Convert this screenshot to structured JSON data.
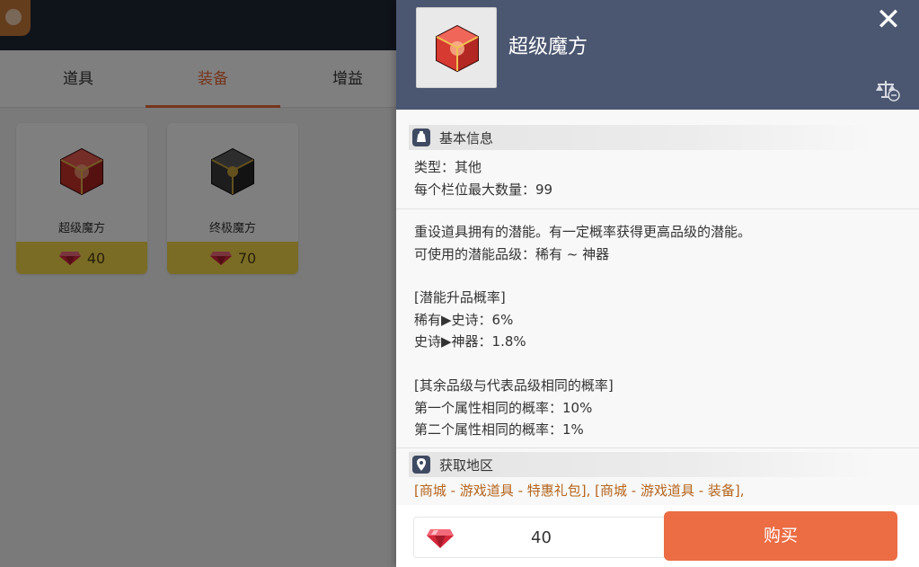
{
  "tabs": [
    {
      "label": "道具"
    },
    {
      "label": "装备"
    },
    {
      "label": "增益"
    }
  ],
  "items": [
    {
      "name": "超级魔方",
      "price": "40"
    },
    {
      "name": "终极魔方",
      "price": "70"
    }
  ],
  "detail": {
    "title": "超级魔方",
    "close_symbol": "✕",
    "basic_info": {
      "header": "基本信息",
      "type": "类型：其他",
      "max_stack": "每个栏位最大数量：99"
    },
    "description": {
      "line1": "重设道具拥有的潜能。有一定概率获得更高品级的潜能。",
      "line2": "可使用的潜能品级：稀有 ~ 神器",
      "upgrade_header": "[潜能升品概率]",
      "upgrade1": "稀有▶史诗：6%",
      "upgrade2": "史诗▶神器：1.8%",
      "same_header": "[其余品级与代表品级相同的概率]",
      "same1": "第一个属性相同的概率：10%",
      "same2": "第二个属性相同的概率：1%"
    },
    "location": {
      "header": "获取地区",
      "line1": "[商城 - 游戏道具 - 特惠礼包], [商城 - 游戏道具 - 装备],"
    },
    "quantity": "40",
    "buy_label": "购买"
  },
  "colors": {
    "accent": "#ec6c43",
    "header_bg": "#4b5670",
    "gold": "#f6d94a"
  },
  "icons": {
    "close": "close-icon",
    "compare": "compare-scale-icon",
    "info": "bag-icon",
    "location": "location-pin-icon",
    "currency": "red-gem-icon"
  }
}
